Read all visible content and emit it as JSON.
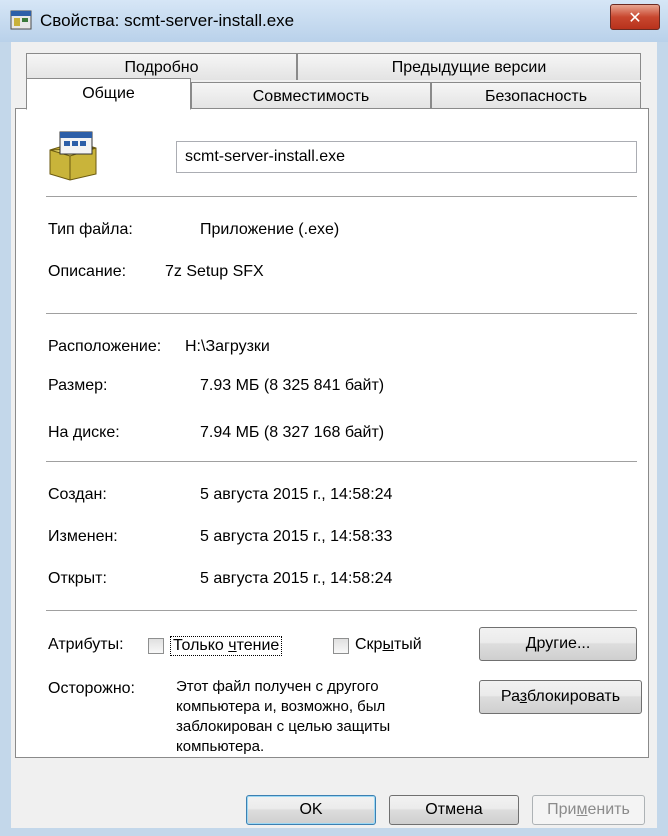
{
  "window": {
    "title": "Свойства: scmt-server-install.exe",
    "close_glyph": "✕"
  },
  "tabs": {
    "row1": [
      "Подробно",
      "Предыдущие версии"
    ],
    "row2": [
      "Общие",
      "Совместимость",
      "Безопасность"
    ],
    "active": "Общие"
  },
  "general": {
    "file_name": "scmt-server-install.exe",
    "file_type_label": "Тип файла:",
    "file_type_value": "Приложение (.exe)",
    "description_label": "Описание:",
    "description_value": "7z Setup SFX",
    "location_label": "Расположение:",
    "location_value": "H:\\Загрузки",
    "size_label": "Размер:",
    "size_value": "7.93 МБ (8 325 841 байт)",
    "disk_label": "На диске:",
    "disk_value": "7.94 МБ (8 327 168 байт)",
    "created_label": "Создан:",
    "created_value": "5 августа 2015 г., 14:58:24",
    "modified_label": "Изменен:",
    "modified_value": "5 августа 2015 г., 14:58:33",
    "opened_label": "Открыт:",
    "opened_value": "5 августа 2015 г., 14:58:24",
    "attributes_label": "Атрибуты:",
    "readonly_pre": "Только ",
    "readonly_ul": "ч",
    "readonly_post": "тение",
    "hidden_pre": "Скр",
    "hidden_ul": "ы",
    "hidden_post": "тый",
    "other_pre": "",
    "other_ul": "Д",
    "other_post": "ругие...",
    "warning_label": "Осторожно:",
    "warning_text": "Этот файл получен с другого компьютера и, возможно, был заблокирован с целью защиты компьютера.",
    "unblock_pre": "Ра",
    "unblock_ul": "з",
    "unblock_post": "блокировать"
  },
  "buttons": {
    "ok": "OK",
    "cancel": "Отмена",
    "apply_pre": "При",
    "apply_ul": "м",
    "apply_post": "енить"
  },
  "icons": {
    "title_icon": "app-window-icon",
    "file_icon": "exe-installer-icon"
  },
  "colors": {
    "frame": "#c3d7ea",
    "close": "#c8472f",
    "dialog": "#f0f0f0"
  }
}
